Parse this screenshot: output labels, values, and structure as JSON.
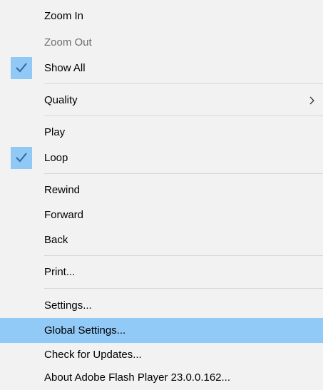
{
  "menu": {
    "zoom_in": "Zoom In",
    "zoom_out": "Zoom Out",
    "show_all": "Show All",
    "quality": "Quality",
    "play": "Play",
    "loop": "Loop",
    "rewind": "Rewind",
    "forward": "Forward",
    "back": "Back",
    "print": "Print...",
    "settings": "Settings...",
    "global_settings": "Global Settings...",
    "check_updates": "Check for Updates...",
    "about": "About Adobe Flash Player 23.0.0.162..."
  },
  "state": {
    "show_all_checked": true,
    "loop_checked": true,
    "zoom_out_disabled": true,
    "highlighted_item": "Global Settings..."
  },
  "colors": {
    "menu_background": "#f2f2f2",
    "highlight": "#91c9f7",
    "disabled_text": "#6d6d6d",
    "separator": "#d7d7d7",
    "check_mark": "#2b6aa4"
  },
  "icons": {
    "checkmark": "check-icon",
    "submenu": "chevron-right-icon"
  }
}
